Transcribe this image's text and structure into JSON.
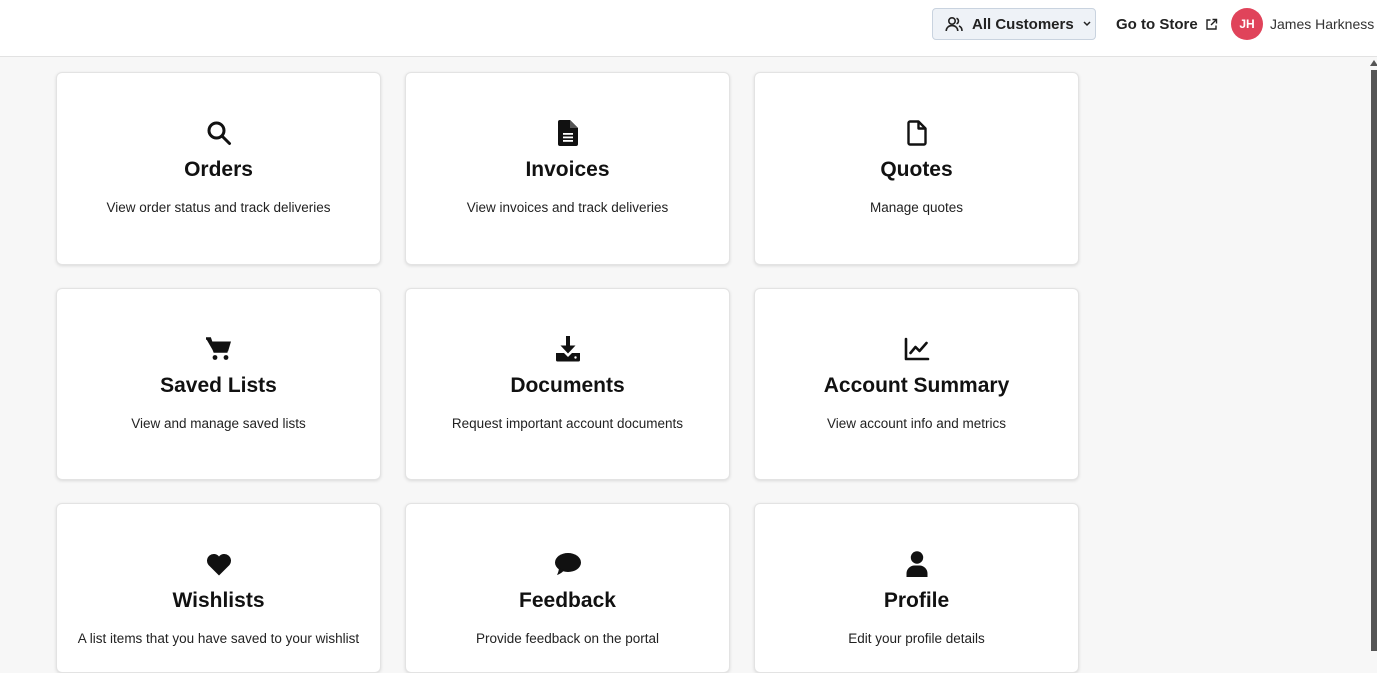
{
  "header": {
    "customer_selector": {
      "label": "All Customers",
      "icon": "users-icon"
    },
    "store_link": {
      "label": "Go to Store",
      "icon": "external-link-icon"
    },
    "user": {
      "initials": "JH",
      "name": "James Harkness",
      "avatar_color": "#e0435a"
    }
  },
  "cards": [
    {
      "title": "Orders",
      "description": "View order status and track deliveries",
      "icon": "search-icon"
    },
    {
      "title": "Invoices",
      "description": "View invoices and track deliveries",
      "icon": "file-text-icon"
    },
    {
      "title": "Quotes",
      "description": "Manage quotes",
      "icon": "file-icon"
    },
    {
      "title": "Saved Lists",
      "description": "View and manage saved lists",
      "icon": "cart-icon"
    },
    {
      "title": "Documents",
      "description": "Request important account documents",
      "icon": "download-icon"
    },
    {
      "title": "Account Summary",
      "description": "View account info and metrics",
      "icon": "chart-line-icon"
    },
    {
      "title": "Wishlists",
      "description": "A list items that you have saved to your wishlist",
      "icon": "heart-icon"
    },
    {
      "title": "Feedback",
      "description": "Provide feedback on the portal",
      "icon": "comment-icon"
    },
    {
      "title": "Profile",
      "description": "Edit your profile details",
      "icon": "user-icon"
    }
  ]
}
